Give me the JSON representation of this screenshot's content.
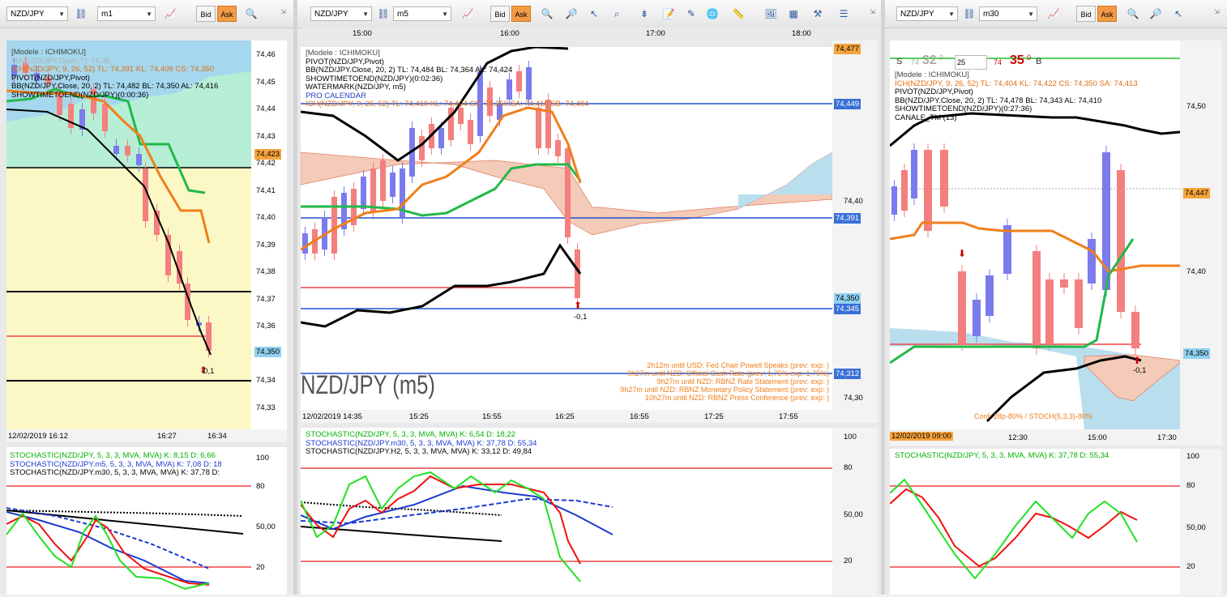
{
  "panels": [
    {
      "symbol": "NZD/JPY",
      "timeframe": "m1",
      "bid_label": "Bid",
      "ask_label": "Ask",
      "legend": [
        {
          "text": "[Modele : ICHIMOKU]",
          "color": "#444444"
        },
        {
          "text": "MA(NZD/JPY.Open,7): 74,38",
          "color": "#b0b0b0"
        },
        {
          "text": "ICH(NZD/JPY, 9, 26, 52)  TL: 74,391  KL: 74,409  CS: 74,350",
          "color": "#e06c12"
        },
        {
          "text": "PIVOT(NZD/JPY,Pivot)",
          "color": "#000000"
        },
        {
          "text": "BB(NZD/JPY.Close, 20, 2)  TL: 74,482  BL: 74,350  AL: 74,416",
          "color": "#000000"
        },
        {
          "text": "SHOWTIMETOEND(NZD/JPY)(0:00:36)",
          "color": "#000000"
        }
      ],
      "y_ticks": [
        "74,46",
        "74,45",
        "74,44",
        "74,43",
        "74,42",
        "74,41",
        "74,40",
        "74,39",
        "74,38",
        "74,37",
        "74,36",
        "74,35",
        "74,34",
        "74,33"
      ],
      "price_tags": [
        {
          "value": "74,423",
          "bg": "#f6a33b"
        },
        {
          "value": "74,350",
          "bg": "#8fd1f0"
        }
      ],
      "x_ticks": [
        "12/02/2019 16:12",
        "16:27",
        "16:34"
      ],
      "last_change": "-0,1",
      "stoch_legend": [
        {
          "text": "STOCHASTIC(NZD/JPY, 5, 3, 3, MVA, MVA)  K: 8,15  D: 6,66",
          "color": "#00b000"
        },
        {
          "text": "STOCHASTIC(NZD/JPY.m5, 5, 3, 3, MVA, MVA)  K: 7,08  D: 18",
          "color": "#1a3ad0"
        },
        {
          "text": "STOCHASTIC(NZD/JPY.m30, 5, 3, 3, MVA, MVA)  K: 37,78  D:",
          "color": "#000000"
        }
      ],
      "stoch_ticks": [
        "100",
        "80",
        "50,00",
        "20"
      ]
    },
    {
      "symbol": "NZD/JPY",
      "timeframe": "m5",
      "bid_label": "Bid",
      "ask_label": "Ask",
      "top_times": [
        "15:00",
        "16:00",
        "17:00",
        "18:00"
      ],
      "legend": [
        {
          "text": "[Modele : ICHIMOKU]",
          "color": "#444444"
        },
        {
          "text": "PIVOT(NZD/JPY,Pivot)",
          "color": "#000000"
        },
        {
          "text": "BB(NZD/JPY.Close, 20, 2)  TL: 74,484  BL: 74,364  AL: 74,424",
          "color": "#000000"
        },
        {
          "text": "SHOWTIMETOEND(NZD/JPY)(0:02:36)",
          "color": "#000000"
        },
        {
          "text": "WATERMARK(NZD/JPY, m5)",
          "color": "#000000"
        },
        {
          "text": "PRO CALENDAR",
          "color": "#2040c0"
        },
        {
          "text": "ICH(NZD/JPY, 9, 26, 52)  TL: 74,410  KL: 74,404  CS: 74,350  SA: 74,410  SB: 74,404",
          "color": "#e06c12"
        }
      ],
      "watermark": "NZD/JPY (m5)",
      "calendar": [
        "2h12m until USD: Fed Chair Powell Speaks (prev:  exp: )",
        "9h27m until NZD: Official Cash Rate (prev: 1,75%  exp: 1,75%)",
        "9h27m until NZD: RBNZ Rate Statement (prev:  exp: )",
        "9h27m until NZD: RBNZ Monetary Policy Statement (prev:  exp: )",
        "10h27m until NZD: RBNZ Press Conference (prev:  exp: )"
      ],
      "y_ticks": [
        "74,40",
        "74,30"
      ],
      "price_tags": [
        {
          "value": "74,477",
          "bg": "#f6a33b"
        },
        {
          "value": "74,449",
          "bg": "#3a6fd8"
        },
        {
          "value": "74,391",
          "bg": "#3a6fd8"
        },
        {
          "value": "74,350",
          "bg": "#8fd1f0"
        },
        {
          "value": "74,345",
          "bg": "#3a6fd8"
        },
        {
          "value": "74,312",
          "bg": "#3a6fd8"
        }
      ],
      "x_ticks": [
        "12/02/2019 14:35",
        "15:25",
        "15:55",
        "16:25",
        "16:55",
        "17:25",
        "17:55"
      ],
      "last_change": "-0,1",
      "stoch_legend": [
        {
          "text": "STOCHASTIC(NZD/JPY, 5, 3, 3, MVA, MVA)  K: 6,54  D: 18,22",
          "color": "#00b000"
        },
        {
          "text": "STOCHASTIC(NZD/JPY.m30, 5, 3, 3, MVA, MVA)  K: 37,78  D: 55,34",
          "color": "#1a3ad0"
        },
        {
          "text": "STOCHASTIC(NZD/JPY.H2, 5, 3, 3, MVA, MVA)  K: 33,12  D: 49,84",
          "color": "#000000"
        }
      ],
      "stoch_ticks": [
        "100",
        "80",
        "50,00",
        "20"
      ]
    },
    {
      "symbol": "NZD/JPY",
      "timeframe": "m30",
      "bid_label": "Bid",
      "ask_label": "Ask",
      "quote": {
        "sell_label": "S",
        "sell_big": "74",
        "sell_pips": "32",
        "sell_frac": "9",
        "qty": "25",
        "buy_big": "74",
        "buy_pips": "35",
        "buy_frac": "0",
        "buy_label": "B"
      },
      "legend": [
        {
          "text": "[Modele : ICHIMOKU]",
          "color": "#444444"
        },
        {
          "text": "ICH(NZD/JPY, 9, 26, 52)  TL: 74,404  KL: 74,422  CS: 74,350  SA: 74,413",
          "color": "#e06c12"
        },
        {
          "text": "PIVOT(NZD/JPY,Pivot)",
          "color": "#000000"
        },
        {
          "text": "BB(NZD/JPY.Close, 20, 2)  TL: 74,478  BL: 74,343  AL: 74,410",
          "color": "#000000"
        },
        {
          "text": "SHOWTIMETOEND(NZD/JPY)(0:27:36)",
          "color": "#000000"
        },
        {
          "text": "CANALE_TM (13)",
          "color": "#000000"
        }
      ],
      "y_ticks": [
        "74,50",
        "74,45",
        "74,40",
        "74,35"
      ],
      "price_tags": [
        {
          "value": "74,447",
          "bg": "#f6a33b"
        },
        {
          "value": "74,350",
          "bg": "#8fd1f0"
        }
      ],
      "conf_text": "Conf: 28p-80% / STOCH(5,3,3)-80%",
      "x_ticks": [
        "12/02/2019 09:00",
        "12:30",
        "15:00",
        "17:30"
      ],
      "last_change": "-0,1",
      "stoch_legend": [
        {
          "text": "STOCHASTIC(NZD/JPY, 5, 3, 3, MVA, MVA)  K: 37,78  D: 55,34",
          "color": "#00b000"
        }
      ],
      "stoch_ticks": [
        "100",
        "80",
        "50,00",
        "20"
      ]
    }
  ],
  "colors": {
    "ask": "#f39a45",
    "bull": "#7b7bee",
    "bear": "#f37f7f",
    "kijun": "#f07f1a",
    "tenkan": "#22b84a",
    "bb": "#000000",
    "level_red": "#f04444",
    "level_blue": "#2050d0"
  }
}
